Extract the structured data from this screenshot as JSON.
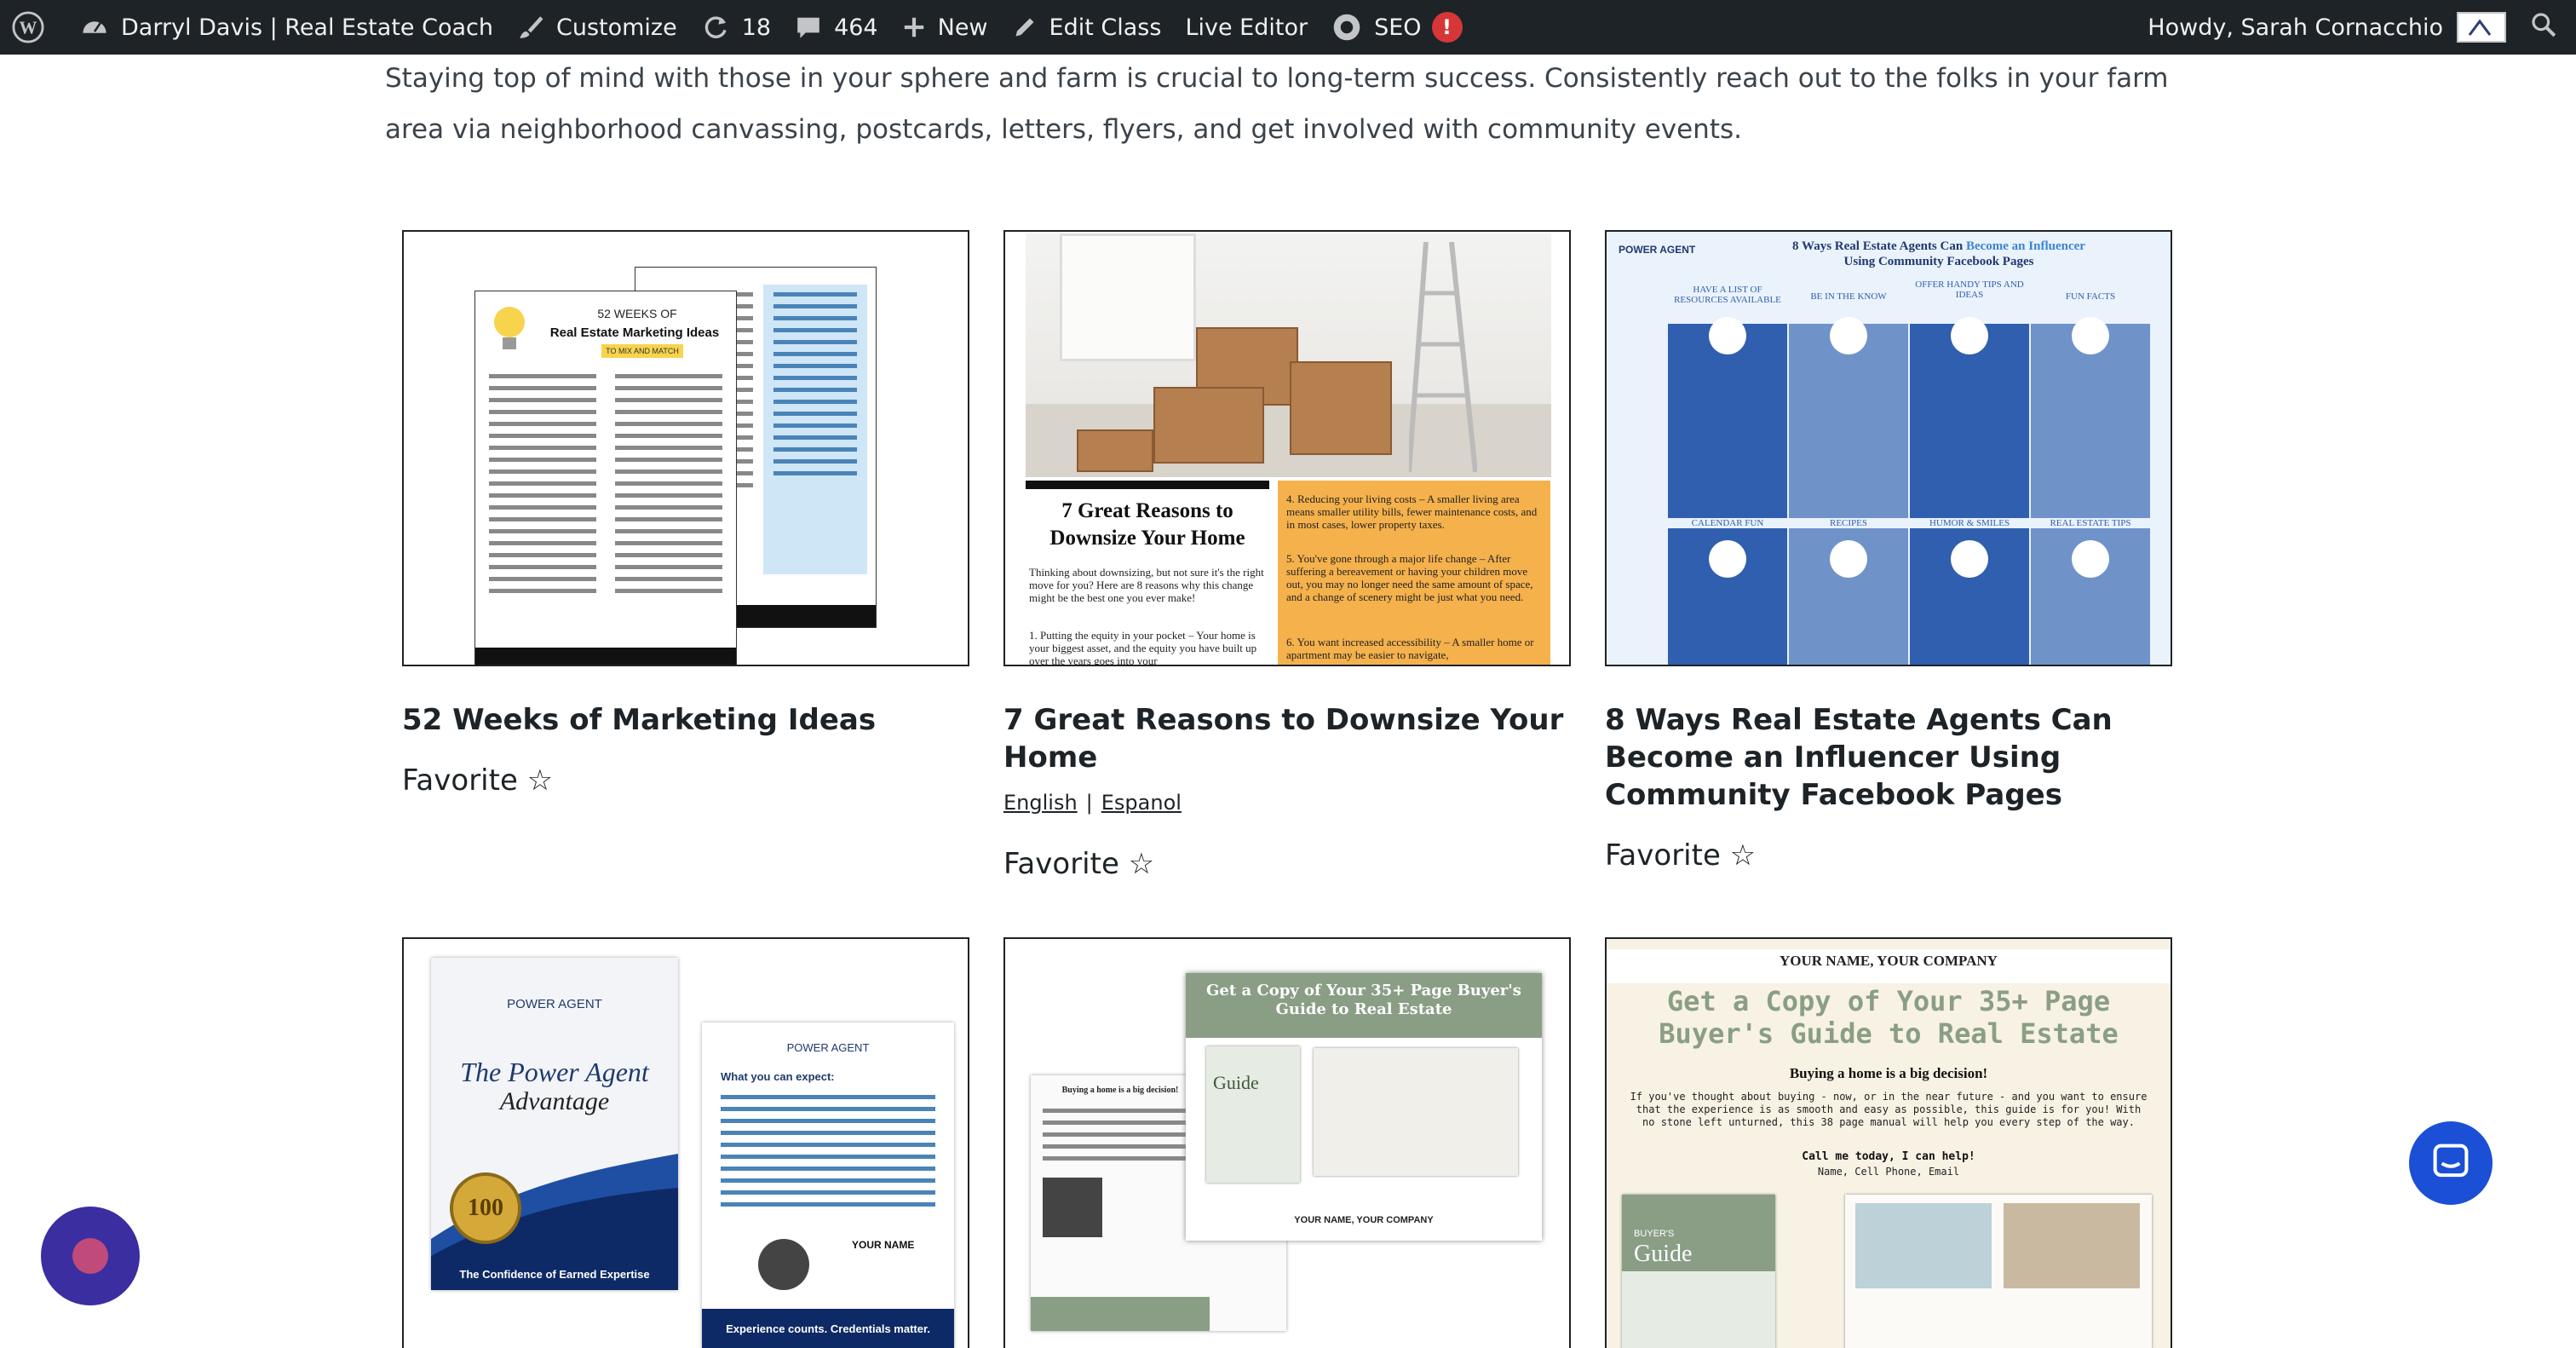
{
  "adminbar": {
    "site_name": "Darryl Davis | Real Estate Coach",
    "customize": "Customize",
    "updates_count": "18",
    "comments_count": "464",
    "new_label": "New",
    "edit_class": "Edit Class",
    "live_editor": "Live Editor",
    "seo_label": "SEO",
    "seo_badge": "!",
    "greeting": "Howdy, Sarah Cornacchio"
  },
  "intro_text": "Staying top of mind with those in your sphere and farm is crucial to long-term success. Consistently reach out to the folks in your farm area via neighborhood canvassing, postcards, letters, flyers, and get involved with community events.",
  "cards": [
    {
      "title": "52 Weeks of Marketing Ideas",
      "favorite": "Favorite ☆",
      "thumb_heading_small": "52 WEEKS OF",
      "thumb_heading": "Real Estate Marketing Ideas",
      "thumb_tag": "TO MIX AND MATCH"
    },
    {
      "title": "7 Great Reasons to Downsize Your Home",
      "favorite": "Favorite ☆",
      "lang_en": "English",
      "lang_sep": "|",
      "lang_es": "Espanol",
      "thumb_heading": "7 Great Reasons to Downsize Your Home",
      "thumb_body": "Thinking about downsizing, but not sure it's the right move for you? Here are 8 reasons why this change might be the best one you ever make!",
      "thumb_point1": "1. Putting the equity in your pocket – Your home is your biggest asset, and the equity you have built up over the years goes into your",
      "thumb_point4": "4. Reducing your living costs – A smaller living area means smaller utility bills, fewer maintenance costs, and in most cases, lower property taxes.",
      "thumb_point5": "5. You've gone through a major life change – After suffering a bereavement or having your children move out, you may no longer need the same amount of space, and a change of scenery might be just what you need.",
      "thumb_point6": "6. You want increased accessibility – A smaller home or apartment may be easier to navigate,"
    },
    {
      "title": "8 Ways Real Estate Agents Can Become an Influencer Using Community Facebook Pages",
      "favorite": "Favorite ☆",
      "thumb_brand": "POWER AGENT",
      "thumb_heading_a": "8 Ways Real Estate Agents Can ",
      "thumb_heading_b": "Become an Influencer",
      "thumb_heading_c": "Using Community Facebook Pages",
      "columns_top": [
        "HAVE A LIST OF RESOURCES AVAILABLE",
        "BE IN THE KNOW",
        "OFFER HANDY TIPS AND IDEAS",
        "FUN FACTS"
      ],
      "columns_bottom": [
        "CALENDAR FUN",
        "RECIPES",
        "HUMOR & SMILES",
        "REAL ESTATE TIPS"
      ]
    },
    {
      "thumb_brand": "POWER AGENT",
      "thumb_title": "The Power Agent",
      "thumb_script": "Advantage",
      "thumb_seal": "100",
      "thumb_footer": "The Confidence of Earned Expertise",
      "thumb_expect": "What you can expect:",
      "thumb_name": "YOUR NAME",
      "thumb_bottom": "Experience counts. Credentials matter."
    },
    {
      "thumb_heading": "Get a Copy of Your 35+ Page Buyer's Guide to Real Estate",
      "thumb_sub": "Buying a home is a big decision!",
      "thumb_guide": "Guide",
      "thumb_company": "YOUR NAME, YOUR COMPANY"
    },
    {
      "thumb_company": "YOUR NAME, YOUR COMPANY",
      "thumb_heading1": "Get a Copy of Your 35+ Page",
      "thumb_heading2": "Buyer's Guide to Real Estate",
      "thumb_sub": "Buying a home is a big decision!",
      "thumb_body": "If you've thought about buying - now, or in the near future - and you want to ensure that the experience is as smooth and easy as possible, this guide is for you! With no stone left unturned, this 38 page manual will help you every step of the way.",
      "thumb_call": "Call me today, I can help!",
      "thumb_contact": "Name, Cell Phone, Email",
      "thumb_guide_small": "BUYER'S",
      "thumb_guide": "Guide"
    }
  ],
  "colors": {
    "adminbar": "#1d2327",
    "seo_badge": "#d63638",
    "intro": "#3c434a",
    "orange": "#f5b14c",
    "blue": "#2f5fae",
    "green": "#8a9e86"
  }
}
